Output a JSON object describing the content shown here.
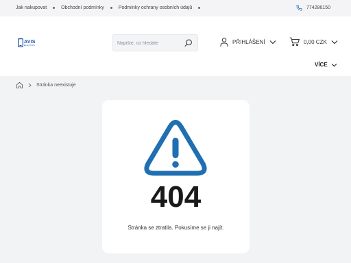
{
  "topbar": {
    "links": [
      "Jak nakupovat",
      "Obchodní podmínky",
      "Podmínky ochrany osobních údajů"
    ],
    "phone": "774286150"
  },
  "logo": {
    "main": "AVIS",
    "sub": "ELEKTRO"
  },
  "search": {
    "placeholder": "Napište, co hledáte"
  },
  "account": {
    "login_label": "PŘIHLÁŠENÍ"
  },
  "cart": {
    "total": "0,00 CZK"
  },
  "nav": {
    "more_label": "VÍCE"
  },
  "breadcrumb": {
    "current": "Stránka neexistuje"
  },
  "error": {
    "code": "404",
    "message": "Stránka se ztratila. Pokusíme se ji najít."
  },
  "colors": {
    "accent": "#1f6fb2",
    "logo": "#1f4fa6",
    "background": "#f2f3f5"
  },
  "icons": {
    "phone": "phone-icon",
    "search": "search-icon",
    "user": "user-icon",
    "cart": "cart-icon",
    "home": "home-icon",
    "warning": "warning-icon"
  }
}
